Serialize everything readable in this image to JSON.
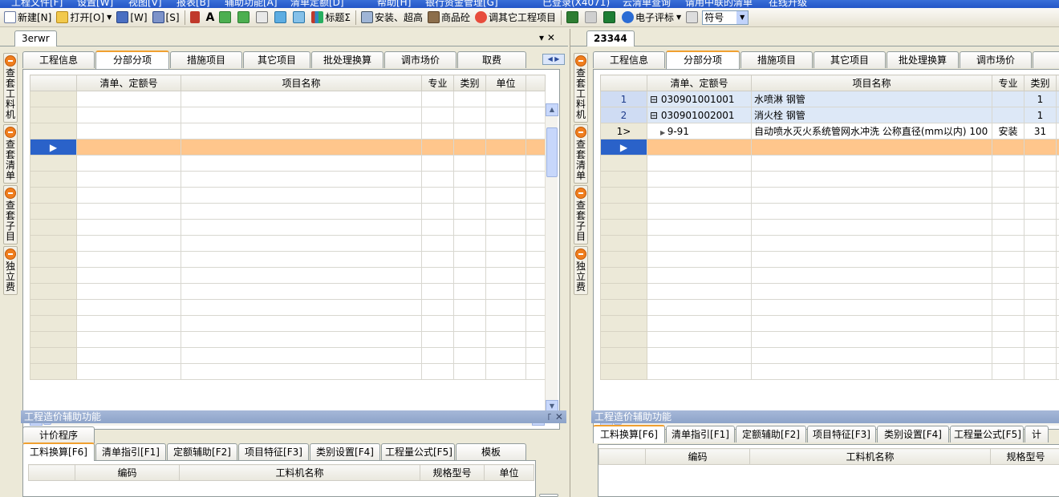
{
  "menu": [
    "工程文件[F]",
    "设置[W]",
    "视图[V]",
    "报表[B]",
    "辅助功能[A]",
    "清单定额[D]",
    "帮助[H]",
    "银行资金管理[G]",
    "已登录(X4071)",
    "云清单查询",
    "请用中联的清单",
    "在线升级"
  ],
  "toolbar": {
    "new": "新建[N]",
    "open": "打开[O]",
    "save_w": "[W]",
    "save_s": "[S]",
    "title_sigma": "标题Σ",
    "install_ultra": "安装、超高",
    "concrete": "商品砼",
    "adjust_other": "调其它工程项目",
    "e_bid": "电子评标",
    "symbol_value": "符号"
  },
  "left_doc": {
    "tab": "3erwr",
    "close": "▾ ✕",
    "side_buttons": [
      "查套工料机",
      "查套清单",
      "查套子目",
      "独立费"
    ],
    "tabs": [
      "工程信息",
      "分部分项",
      "措施项目",
      "其它项目",
      "批处理换算",
      "调市场价",
      "取费"
    ],
    "selected_tab": 1,
    "columns": [
      "清单、定额号",
      "项目名称",
      "专业",
      "类别",
      "单位"
    ],
    "aux_title": "工程造价辅助功能",
    "aux_ctl": "꜒ ✕",
    "aux_tabs_row1": [
      "计价程序"
    ],
    "aux_tabs_row2": [
      "工料换算[F6]",
      "清单指引[F1]",
      "定额辅助[F2]",
      "项目特征[F3]",
      "类别设置[F4]",
      "工程量公式[F5]",
      "模板"
    ],
    "aux_columns": [
      "编码",
      "工料机名称",
      "规格型号",
      "单位"
    ]
  },
  "right_doc": {
    "tab": "23344",
    "side_buttons": [
      "查套工料机",
      "查套清单",
      "查套子目",
      "独立费"
    ],
    "tabs": [
      "工程信息",
      "分部分项",
      "措施项目",
      "其它项目",
      "批处理换算",
      "调市场价"
    ],
    "selected_tab": 1,
    "columns": [
      "清单、定额号",
      "项目名称",
      "专业",
      "类别"
    ],
    "rows": [
      {
        "num": "1",
        "code": "030901001001",
        "name": "水喷淋 钢管",
        "major": "",
        "cat": "1",
        "kind": "group"
      },
      {
        "num": "2",
        "code": "030901002001",
        "name": "消火栓 钢管",
        "major": "",
        "cat": "1",
        "kind": "group"
      },
      {
        "num": "1>",
        "code": "9-91",
        "name": "自动喷水灭火系统管网水冲洗 公称直径(mm以内) 100",
        "major": "安装",
        "cat": "31",
        "kind": "item"
      }
    ],
    "aux_title": "工程造价辅助功能",
    "aux_tabs": [
      "工料换算[F6]",
      "清单指引[F1]",
      "定额辅助[F2]",
      "项目特征[F3]",
      "类别设置[F4]",
      "工程量公式[F5]",
      "计"
    ],
    "aux_columns": [
      "编码",
      "工料机名称",
      "规格型号"
    ]
  }
}
